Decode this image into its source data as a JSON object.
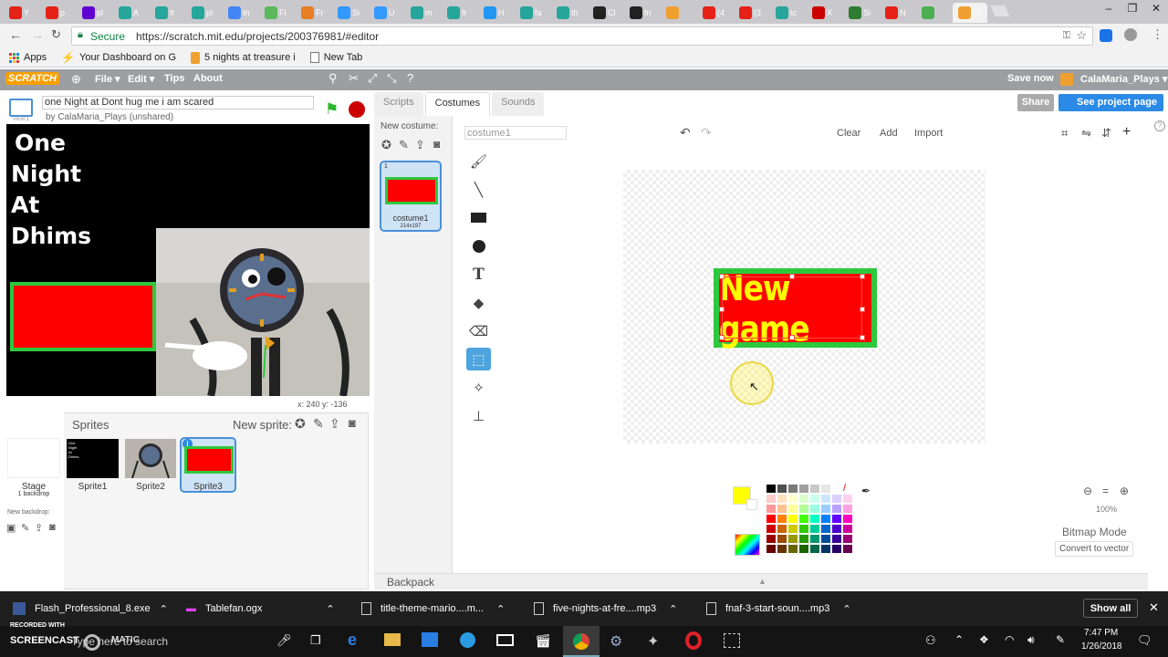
{
  "browser": {
    "tabs": [
      {
        "title": "Y",
        "color": "#e62117"
      },
      {
        "title": "p",
        "color": "#e62117"
      },
      {
        "title": "pl",
        "color": "#6001d2"
      },
      {
        "title": "A",
        "color": "#26a69a"
      },
      {
        "title": "fr",
        "color": "#26a69a"
      },
      {
        "title": "pl",
        "color": "#26a69a"
      },
      {
        "title": "In",
        "color": "#4285f4"
      },
      {
        "title": "Fi",
        "color": "#5cb85c"
      },
      {
        "title": "Fr",
        "color": "#e67e22"
      },
      {
        "title": "Si",
        "color": "#3399ff"
      },
      {
        "title": "U",
        "color": "#3399ff"
      },
      {
        "title": "m",
        "color": "#26a69a"
      },
      {
        "title": "fr",
        "color": "#26a69a"
      },
      {
        "title": "H",
        "color": "#2196f3"
      },
      {
        "title": "fa",
        "color": "#26a69a"
      },
      {
        "title": "th",
        "color": "#26a69a"
      },
      {
        "title": "Cl",
        "color": "#222222"
      },
      {
        "title": "fn",
        "color": "#222222"
      },
      {
        "title": "",
        "color": "#f0a030"
      },
      {
        "title": "(4",
        "color": "#e62117"
      },
      {
        "title": "(3",
        "color": "#e62117"
      },
      {
        "title": "tc",
        "color": "#26a69a"
      },
      {
        "title": "X",
        "color": "#cc0000"
      },
      {
        "title": "Si",
        "color": "#2e7d32"
      },
      {
        "title": "N",
        "color": "#e62117"
      },
      {
        "title": "",
        "color": "#4caf50"
      },
      {
        "title": "Fr",
        "color": "#f0a030"
      }
    ],
    "address": {
      "secure_label": "Secure",
      "url": "https://scratch.mit.edu/projects/200376981/#editor"
    },
    "bookmarks": [
      {
        "label": "Apps"
      },
      {
        "label": "Your Dashboard on G"
      },
      {
        "label": "5 nights at treasure i"
      },
      {
        "label": "New Tab"
      }
    ]
  },
  "scratch": {
    "logo": "SCRATCH",
    "menu": {
      "file": "File",
      "edit": "Edit",
      "tips": "Tips",
      "about": "About",
      "save_now": "Save now",
      "user": "CalaMaria_Plays"
    },
    "project": {
      "version": "v458.1",
      "title": "one Night at Dont hug me i am scared",
      "byline": "by CalaMaria_Plays (unshared)",
      "share": "Share",
      "see_project_page": "See project page"
    },
    "stage": {
      "text_lines": [
        "One",
        "Night",
        "At",
        "Dhims"
      ],
      "coords": "x: 240   y: -136"
    },
    "sprites": {
      "header": "Sprites",
      "new_sprite": "New sprite:",
      "stage_label": "Stage",
      "stage_sub": "1 backdrop",
      "new_backdrop": "New backdrop:",
      "items": [
        {
          "name": "Sprite1"
        },
        {
          "name": "Sprite2"
        },
        {
          "name": "Sprite3",
          "selected": true
        }
      ],
      "sprite1_thumb_lines": [
        "One",
        "Night",
        "At",
        "Dhims"
      ]
    },
    "editor": {
      "tabs": [
        "Scripts",
        "Costumes",
        "Sounds"
      ],
      "active_tab": "Costumes",
      "new_costume": "New costume:",
      "costume": {
        "index": "1",
        "name": "costume1",
        "size": "214x197"
      },
      "costume_name_field": "costume1",
      "clear": "Clear",
      "add": "Add",
      "import": "Import",
      "canvas_text": "New game",
      "zoom": "100%",
      "mode": "Bitmap Mode",
      "convert": "Convert to vector",
      "backpack": "Backpack",
      "fill_color": "#ffff00"
    }
  },
  "taskbar": {
    "downloads": [
      {
        "name": "Flash_Professional_8.exe"
      },
      {
        "name": "Tablefan.ogx"
      },
      {
        "name": "title-theme-mario....m..."
      },
      {
        "name": "five-nights-at-fre....mp3"
      },
      {
        "name": "fnaf-3-start-soun....mp3"
      }
    ],
    "show_all": "Show all",
    "watermark_line1": "RECORDED WITH",
    "watermark_line2": "SCREENCAST",
    "watermark_line3": "MATIC",
    "search": "Type here to search",
    "time": "7:47 PM",
    "date": "1/26/2018"
  }
}
